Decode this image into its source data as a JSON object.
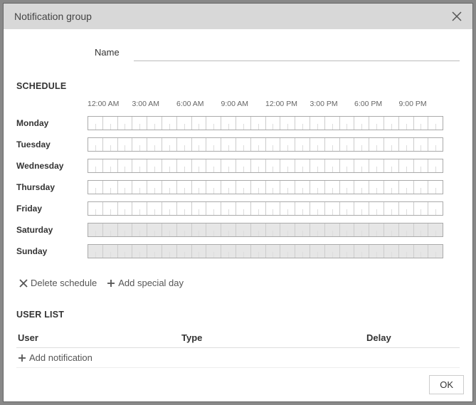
{
  "dialog": {
    "title": "Notification group",
    "name_label": "Name",
    "name_value": "",
    "schedule_heading": "SCHEDULE",
    "time_labels": [
      "12:00 AM",
      "3:00 AM",
      "6:00 AM",
      "9:00 AM",
      "12:00 PM",
      "3:00 PM",
      "6:00 PM",
      "9:00 PM"
    ],
    "days": [
      {
        "label": "Monday",
        "weekend": false
      },
      {
        "label": "Tuesday",
        "weekend": false
      },
      {
        "label": "Wednesday",
        "weekend": false
      },
      {
        "label": "Thursday",
        "weekend": false
      },
      {
        "label": "Friday",
        "weekend": false
      },
      {
        "label": "Saturday",
        "weekend": true
      },
      {
        "label": "Sunday",
        "weekend": true
      }
    ],
    "delete_schedule_label": "Delete schedule",
    "add_special_day_label": "Add special day",
    "userlist_heading": "USER LIST",
    "columns": {
      "user": "User",
      "type": "Type",
      "delay": "Delay"
    },
    "add_notification_label": "Add notification",
    "ok_label": "OK"
  }
}
